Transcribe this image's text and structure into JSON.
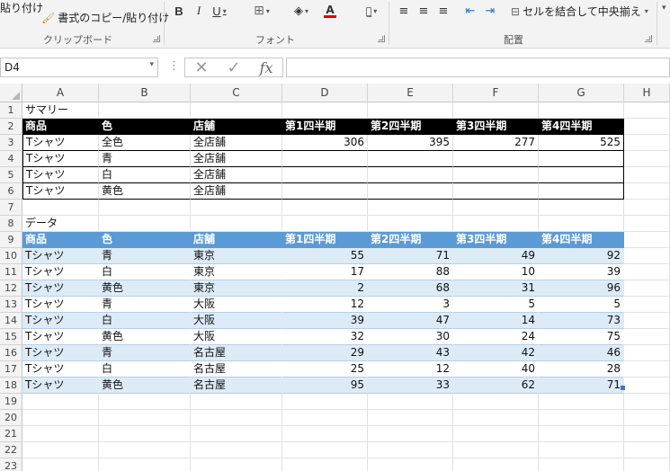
{
  "ribbon": {
    "clipboard": {
      "paste": "貼り付け",
      "copy_format": "書式のコピー/貼り付け",
      "group_label": "クリップボード"
    },
    "font": {
      "bold": "B",
      "italic": "I",
      "underline": "U",
      "group_label": "フォント"
    },
    "alignment": {
      "merge_center": "セルを結合して中央揃え",
      "group_label": "配置"
    }
  },
  "formula_bar": {
    "name_box": "D4",
    "formula": ""
  },
  "columns": [
    "A",
    "B",
    "C",
    "D",
    "E",
    "F",
    "G",
    "H"
  ],
  "rows": [
    "1",
    "2",
    "3",
    "4",
    "5",
    "6",
    "7",
    "8",
    "9",
    "10",
    "11",
    "12",
    "13",
    "14",
    "15",
    "16",
    "17",
    "18",
    "19",
    "20",
    "21",
    "22",
    "23"
  ],
  "summary": {
    "title": "サマリー",
    "headers": [
      "商品",
      "色",
      "店舗",
      "第1四半期",
      "第2四半期",
      "第3四半期",
      "第4四半期"
    ],
    "rows": [
      [
        "Tシャツ",
        "全色",
        "全店舗",
        "306",
        "395",
        "277",
        "525"
      ],
      [
        "Tシャツ",
        "青",
        "全店舗",
        "",
        "",
        "",
        ""
      ],
      [
        "Tシャツ",
        "白",
        "全店舗",
        "",
        "",
        "",
        ""
      ],
      [
        "Tシャツ",
        "黄色",
        "全店舗",
        "",
        "",
        "",
        ""
      ]
    ]
  },
  "data_section": {
    "title": "データ",
    "headers": [
      "商品",
      "色",
      "店舗",
      "第1四半期",
      "第2四半期",
      "第3四半期",
      "第4四半期"
    ],
    "rows": [
      [
        "Tシャツ",
        "青",
        "東京",
        "55",
        "71",
        "49",
        "92"
      ],
      [
        "Tシャツ",
        "白",
        "東京",
        "17",
        "88",
        "10",
        "39"
      ],
      [
        "Tシャツ",
        "黄色",
        "東京",
        "2",
        "68",
        "31",
        "96"
      ],
      [
        "Tシャツ",
        "青",
        "大阪",
        "12",
        "3",
        "5",
        "5"
      ],
      [
        "Tシャツ",
        "白",
        "大阪",
        "39",
        "47",
        "14",
        "73"
      ],
      [
        "Tシャツ",
        "黄色",
        "大阪",
        "32",
        "30",
        "24",
        "75"
      ],
      [
        "Tシャツ",
        "青",
        "名古屋",
        "29",
        "43",
        "42",
        "46"
      ],
      [
        "Tシャツ",
        "白",
        "名古屋",
        "25",
        "12",
        "40",
        "28"
      ],
      [
        "Tシャツ",
        "黄色",
        "名古屋",
        "95",
        "33",
        "62",
        "71"
      ]
    ]
  },
  "colors": {
    "table_header": "#5b9bd5",
    "band": "#ddebf7",
    "summary_header": "#000000",
    "font_color_bar": "#e00000"
  }
}
